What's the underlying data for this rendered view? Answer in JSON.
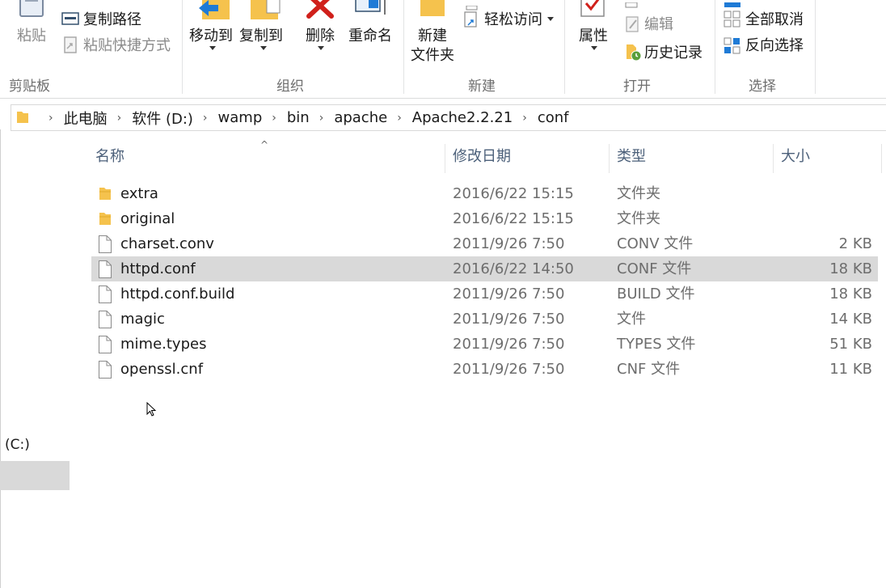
{
  "ribbon": {
    "clipboard": {
      "paste_label": "粘贴",
      "copy_path_label": "复制路径",
      "paste_shortcut_label": "粘贴快捷方式",
      "group_label": "剪贴板"
    },
    "organize": {
      "move_to_label": "移动到",
      "copy_to_label": "复制到",
      "delete_label": "删除",
      "rename_label": "重命名",
      "group_label": "组织"
    },
    "new": {
      "new_folder_line1": "新建",
      "new_folder_line2": "文件夹",
      "easy_access_label": "轻松访问",
      "group_label": "新建"
    },
    "open": {
      "properties_label": "属性",
      "edit_label": "编辑",
      "history_label": "历史记录",
      "group_label": "打开"
    },
    "select": {
      "select_none_label": "全部取消",
      "invert_selection_label": "反向选择",
      "group_label": "选择"
    }
  },
  "address": {
    "crumbs": [
      "此电脑",
      "软件 (D:)",
      "wamp",
      "bin",
      "apache",
      "Apache2.2.21",
      "conf"
    ]
  },
  "columns": {
    "name": "名称",
    "date": "修改日期",
    "type": "类型",
    "size": "大小"
  },
  "files": [
    {
      "name": "extra",
      "date": "2016/6/22 15:15",
      "type": "文件夹",
      "size": "",
      "kind": "folder-icon"
    },
    {
      "name": "original",
      "date": "2016/6/22 15:15",
      "type": "文件夹",
      "size": "",
      "kind": "folder-icon"
    },
    {
      "name": "charset.conv",
      "date": "2011/9/26 7:50",
      "type": "CONV 文件",
      "size": "2 KB",
      "kind": "file-icon"
    },
    {
      "name": "httpd.conf",
      "date": "2016/6/22 14:50",
      "type": "CONF 文件",
      "size": "18 KB",
      "kind": "file-icon",
      "selected": true
    },
    {
      "name": "httpd.conf.build",
      "date": "2011/9/26 7:50",
      "type": "BUILD 文件",
      "size": "18 KB",
      "kind": "file-icon"
    },
    {
      "name": "magic",
      "date": "2011/9/26 7:50",
      "type": "文件",
      "size": "14 KB",
      "kind": "file-icon"
    },
    {
      "name": "mime.types",
      "date": "2011/9/26 7:50",
      "type": "TYPES 文件",
      "size": "51 KB",
      "kind": "file-icon"
    },
    {
      "name": "openssl.cnf",
      "date": "2011/9/26 7:50",
      "type": "CNF 文件",
      "size": "11 KB",
      "kind": "file-icon"
    }
  ],
  "nav": {
    "drive_label": "(C:)"
  },
  "colors": {
    "selection": "#d9d9d9",
    "header_text": "#4c607a",
    "group_label": "#6d6d6d",
    "folder": "#f5c24d",
    "delete_red": "#d0201b",
    "accent_blue": "#1f7bd6"
  }
}
